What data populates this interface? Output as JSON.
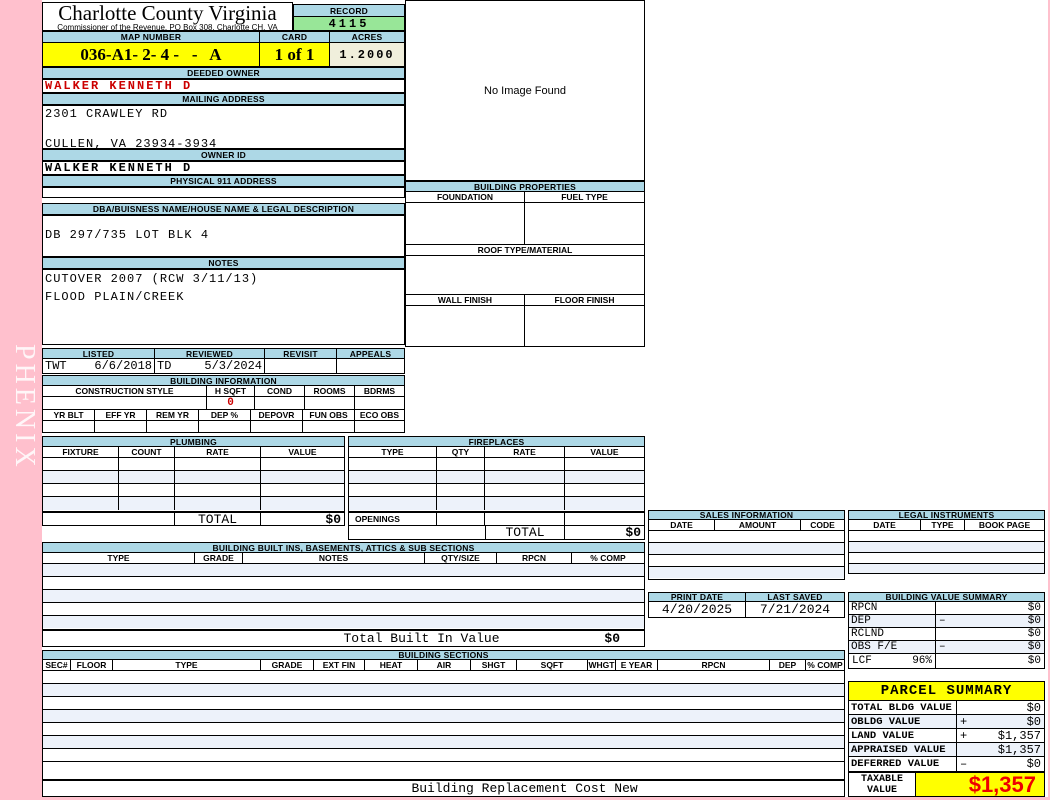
{
  "page": {
    "watermark": "PHENIX"
  },
  "header": {
    "county": "Charlotte County Virginia",
    "subtitle": "Commissioner of the Revenue, PO Box 308, Charlotte CH, VA",
    "record_label": "RECORD",
    "record_value": "4115",
    "map_number_label": "MAP NUMBER",
    "map_number": "036-A1- 2- 4 -   -   A",
    "card_label": "CARD",
    "card": "1 of 1",
    "acres_label": "ACRES",
    "acres": "1.2000"
  },
  "owner": {
    "deeded_owner_label": "DEEDED OWNER",
    "deeded_owner": "WALKER KENNETH D",
    "mailing_label": "MAILING ADDRESS",
    "mailing_line1": "2301 CRAWLEY RD",
    "mailing_line2": "CULLEN, VA 23934-3934",
    "owner_id_label": "OWNER ID",
    "owner_id": "WALKER KENNETH D",
    "physical_label": "PHYSICAL 911 ADDRESS"
  },
  "legal": {
    "dba_label": "DBA/BUISNESS NAME/HOUSE NAME & LEGAL DESCRIPTION",
    "description": "DB 297/735 LOT BLK 4",
    "notes_label": "NOTES",
    "notes_line1": "CUTOVER 2007 (RCW 3/11/13)",
    "notes_line2": "FLOOD PLAIN/CREEK"
  },
  "review": {
    "listed_label": "LISTED",
    "listed_by": "TWT",
    "listed_date": "6/6/2018",
    "reviewed_label": "REVIEWED",
    "reviewed_by": "TD",
    "reviewed_date": "5/3/2024",
    "revisit_label": "REVISIT",
    "appeals_label": "APPEALS"
  },
  "building_info": {
    "title": "BUILDING INFORMATION",
    "row1_headers": [
      "CONSTRUCTION STYLE",
      "H SQFT",
      "COND",
      "ROOMS",
      "BDRMS"
    ],
    "h_sqft": "0",
    "row2_headers": [
      "YR BLT",
      "EFF YR",
      "REM YR",
      "DEP %",
      "DEPOVR",
      "FUN OBS",
      "ECO OBS"
    ]
  },
  "plumbing": {
    "title": "PLUMBING",
    "columns": [
      "FIXTURE",
      "COUNT",
      "RATE",
      "VALUE"
    ],
    "total_label": "TOTAL",
    "total_value": "$0"
  },
  "fireplaces": {
    "title": "FIREPLACES",
    "columns": [
      "TYPE",
      "QTY",
      "RATE",
      "VALUE"
    ],
    "openings_label": "OPENINGS",
    "total_label": "TOTAL",
    "total_value": "$0"
  },
  "built_ins": {
    "title": "BUILDING BUILT INS, BASEMENTS, ATTICS & SUB SECTIONS",
    "columns": [
      "TYPE",
      "GRADE",
      "NOTES",
      "QTY/SIZE",
      "RPCN",
      "% COMP"
    ],
    "total_label": "Total Built In Value",
    "total_value": "$0"
  },
  "building_sections": {
    "title": "BUILDING SECTIONS",
    "columns": [
      "SEC#",
      "FLOOR",
      "TYPE",
      "GRADE",
      "EXT FIN",
      "HEAT",
      "AIR",
      "SHGT",
      "SQFT",
      "WHGT",
      "E YEAR",
      "RPCN",
      "DEP",
      "% COMP"
    ],
    "footer": "Building Replacement Cost New"
  },
  "image_panel": {
    "no_image_text": "No Image Found"
  },
  "building_properties": {
    "title": "BUILDING PROPERTIES",
    "foundation_label": "FOUNDATION",
    "fuel_label": "FUEL TYPE",
    "roof_label": "ROOF TYPE/MATERIAL",
    "wall_label": "WALL FINISH",
    "floor_label": "FLOOR FINISH"
  },
  "sales": {
    "title": "SALES INFORMATION",
    "columns": [
      "DATE",
      "AMOUNT",
      "CODE"
    ]
  },
  "legal_instruments": {
    "title": "LEGAL INSTRUMENTS",
    "columns": [
      "DATE",
      "TYPE",
      "BOOK PAGE"
    ]
  },
  "dates": {
    "print_label": "PRINT DATE",
    "print_date": "4/20/2025",
    "saved_label": "LAST SAVED",
    "saved_date": "7/21/2024"
  },
  "value_summary": {
    "title": "BUILDING VALUE SUMMARY",
    "rows": [
      {
        "label": "RPCN",
        "op": "",
        "value": "$0"
      },
      {
        "label": "DEP",
        "op": "–",
        "value": "$0"
      },
      {
        "label": "RCLND",
        "op": "",
        "value": "$0"
      },
      {
        "label": "OBS F/E",
        "op": "–",
        "value": "$0"
      },
      {
        "label": "LCF",
        "pct": "96%",
        "op": "",
        "value": "$0"
      }
    ]
  },
  "parcel_summary": {
    "title": "PARCEL SUMMARY",
    "rows": [
      {
        "label": "TOTAL BLDG VALUE",
        "op": "",
        "value": "$0"
      },
      {
        "label": "OBLDG VALUE",
        "op": "+",
        "value": "$0"
      },
      {
        "label": "LAND VALUE",
        "op": "+",
        "value": "$1,357"
      },
      {
        "label": "APPRAISED VALUE",
        "op": "",
        "value": "$1,357"
      },
      {
        "label": "DEFERRED VALUE",
        "op": "–",
        "value": "$0"
      }
    ],
    "taxable_line1": "TAXABLE",
    "taxable_line2": "VALUE",
    "taxable_value": "$1,357"
  }
}
